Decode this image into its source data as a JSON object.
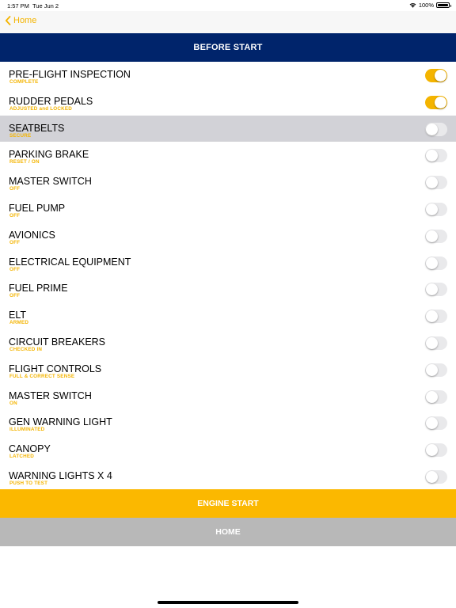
{
  "status": {
    "time": "1:57 PM",
    "date": "Tue Jun 2",
    "battery": "100%",
    "battery_level": 1.0
  },
  "nav": {
    "back_label": "Home",
    "back_icon": "chevron-left-icon"
  },
  "colors": {
    "accent": "#f4b400",
    "header_bg": "#00246b",
    "engine_button_bg": "#fbb800",
    "home_button_bg": "#b8b8b8",
    "selected_row_bg": "#d2d2d7"
  },
  "section": {
    "title": "BEFORE START"
  },
  "items": [
    {
      "title": "PRE-FLIGHT INSPECTION",
      "subtitle": "COMPLETE",
      "checked": true,
      "selected": false
    },
    {
      "title": "RUDDER PEDALS",
      "subtitle": "ADJUSTED and LOCKED",
      "checked": true,
      "selected": false
    },
    {
      "title": "SEATBELTS",
      "subtitle": "SECURE",
      "checked": false,
      "selected": true
    },
    {
      "title": "PARKING BRAKE",
      "subtitle": "RESET / ON",
      "checked": false,
      "selected": false
    },
    {
      "title": "MASTER SWITCH",
      "subtitle": "OFF",
      "checked": false,
      "selected": false
    },
    {
      "title": "FUEL PUMP",
      "subtitle": "OFF",
      "checked": false,
      "selected": false
    },
    {
      "title": "AVIONICS",
      "subtitle": "OFF",
      "checked": false,
      "selected": false
    },
    {
      "title": "ELECTRICAL EQUIPMENT",
      "subtitle": "OFF",
      "checked": false,
      "selected": false
    },
    {
      "title": "FUEL PRIME",
      "subtitle": "OFF",
      "checked": false,
      "selected": false
    },
    {
      "title": "ELT",
      "subtitle": "ARMED",
      "checked": false,
      "selected": false
    },
    {
      "title": "CIRCUIT BREAKERS",
      "subtitle": "CHECKED IN",
      "checked": false,
      "selected": false
    },
    {
      "title": "FLIGHT CONTROLS",
      "subtitle": "FULL & CORRECT SENSE",
      "checked": false,
      "selected": false
    },
    {
      "title": "MASTER SWITCH",
      "subtitle": "ON",
      "checked": false,
      "selected": false
    },
    {
      "title": "GEN WARNING LIGHT",
      "subtitle": "ILLUMINATED",
      "checked": false,
      "selected": false
    },
    {
      "title": "CANOPY",
      "subtitle": "LATCHED",
      "checked": false,
      "selected": false
    },
    {
      "title": "WARNING LIGHTS X 4",
      "subtitle": "PUSH TO TEST",
      "checked": false,
      "selected": false
    }
  ],
  "buttons": {
    "engine_start": "ENGINE START",
    "home": "HOME"
  }
}
